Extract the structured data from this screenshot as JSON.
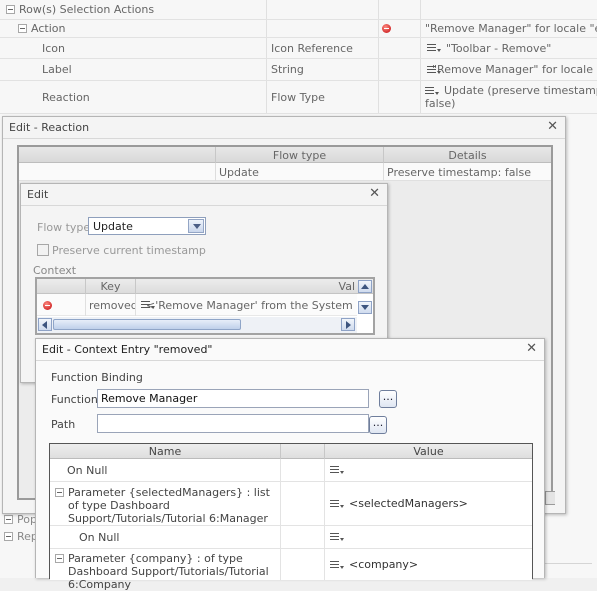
{
  "background_table": {
    "section_header": "Row(s) Selection Actions",
    "action_row": {
      "label": "Action",
      "value": "\"Remove Manager\" for locale \"en\""
    },
    "icon_row": {
      "label": "Icon",
      "type": "Icon Reference",
      "value": "\"Toolbar - Remove\""
    },
    "label_row": {
      "label": "Label",
      "type": "String",
      "value": "\"Remove Manager\" for locale \"e"
    },
    "reaction_row": {
      "label": "Reaction",
      "type": "Flow Type",
      "value_line1": "Update (preserve timestamp:",
      "value_line2": "false)"
    },
    "bottom_items": [
      "Pop",
      "Rep"
    ]
  },
  "reaction_dialog": {
    "title": "Edit - Reaction",
    "columns": {
      "flow_type": "Flow type",
      "details": "Details"
    },
    "row": {
      "flow_type": "Update",
      "details": "Preserve timestamp: false"
    }
  },
  "edit_dialog": {
    "title": "Edit",
    "flow_type_label": "Flow type",
    "flow_type_value": "Update",
    "preserve_label": "Preserve current timestamp",
    "context_label": "Context",
    "context_columns": {
      "key": "Key",
      "value": "Val"
    },
    "context_row": {
      "key": "removed",
      "value": "<'Remove Manager' from the System mod"
    }
  },
  "context_entry_dialog": {
    "title": "Edit - Context Entry \"removed\"",
    "section_title": "Function Binding",
    "function_label": "Function",
    "function_value": "Remove Manager",
    "path_label": "Path",
    "path_value": "",
    "ellipsis": "...",
    "table": {
      "name_header": "Name",
      "value_header": "Value",
      "rows": [
        {
          "name": "On Null",
          "value": ""
        },
        {
          "name": "Parameter {selectedManagers} : list of type Dashboard Support/Tutorials/Tutorial 6:Manager",
          "value": "<selectedManagers>"
        },
        {
          "name": "On Null",
          "value": ""
        },
        {
          "name": "Parameter {company} : of type Dashboard Support/Tutorials/Tutorial 6:Company",
          "value": "<company>"
        }
      ]
    }
  }
}
